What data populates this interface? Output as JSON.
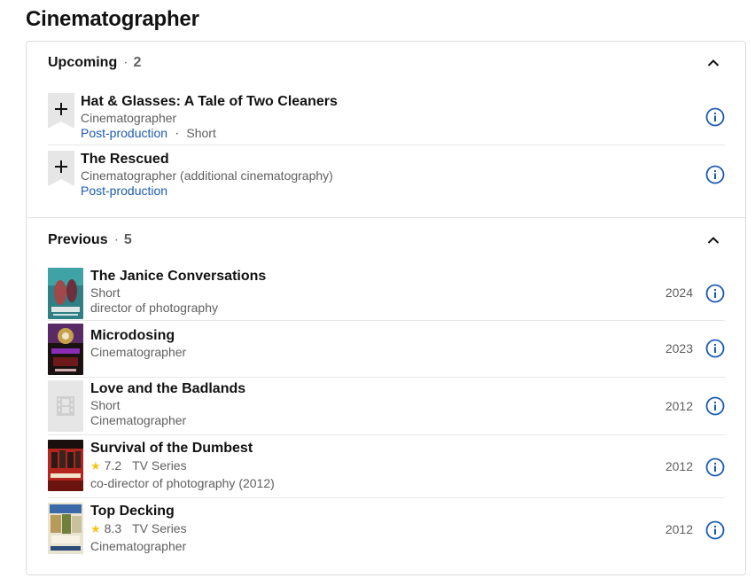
{
  "page": {
    "title": "Cinematographer"
  },
  "upcoming": {
    "label": "Upcoming",
    "count": "2",
    "items": [
      {
        "title": "Hat & Glasses: A Tale of Two Cleaners",
        "role": "Cinematographer",
        "status": "Post-production",
        "type": "Short"
      },
      {
        "title": "The Rescued",
        "role": "Cinematographer (additional cinematography)",
        "status": "Post-production"
      }
    ]
  },
  "previous": {
    "label": "Previous",
    "count": "5",
    "items": [
      {
        "title": "The Janice Conversations",
        "line1": "Short",
        "line2": "director of photography",
        "year": "2024"
      },
      {
        "title": "Microdosing",
        "line1": "Cinematographer",
        "year": "2023"
      },
      {
        "title": "Love and the Badlands",
        "line1": "Short",
        "line2": "Cinematographer",
        "year": "2012"
      },
      {
        "title": "Survival of the Dumbest",
        "rating": "7.2",
        "type": "TV Series",
        "line2": "co-director of photography (2012)",
        "year": "2012"
      },
      {
        "title": "Top Decking",
        "rating": "8.3",
        "type": "TV Series",
        "line2": "Cinematographer",
        "year": "2012"
      }
    ]
  },
  "colors": {
    "link": "#1c5bb5",
    "star": "#f5c518",
    "info_icon": "#1c5bb5"
  },
  "icons": {
    "collapse": "chevron-up-icon",
    "info": "info-icon",
    "add": "plus-icon",
    "star": "star-icon"
  }
}
